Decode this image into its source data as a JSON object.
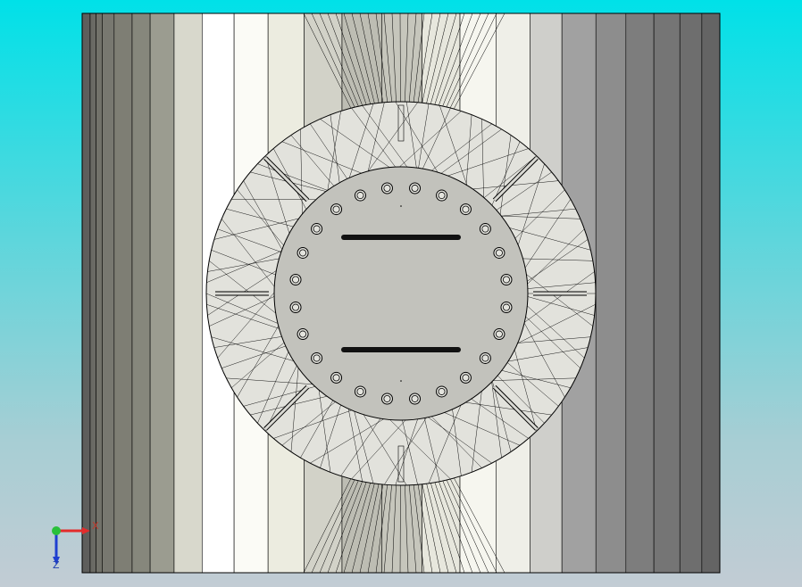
{
  "viewport": {
    "background_top": "#00e1e8",
    "background_bottom": "#c2ccd4"
  },
  "model": {
    "stripe_colors": [
      "#5e5e5c",
      "#6a6a64",
      "#72726a",
      "#787870",
      "#7e7e74",
      "#86877c",
      "#9b9c90",
      "#d8d8cc",
      "#ffffff",
      "#fbfbf6",
      "#ecece0",
      "#d2d2c8",
      "#bdbdb3",
      "#c6c6bc",
      "#e7e7dd",
      "#f6f6ef",
      "#efefe8",
      "#cfcfcb",
      "#a1a1a1",
      "#8d8d8d",
      "#7d7d7d",
      "#757575",
      "#6e6e6e",
      "#646464"
    ],
    "outline_color": "#000000",
    "flange_fill": "#e2e2dc",
    "hub_fill": "#c2c2bc",
    "bolt_count": 24,
    "slot_color": "#111111"
  },
  "triad": {
    "x_label": "X",
    "z_label": "Z",
    "x_color": "#e32b2b",
    "z_color": "#1f3fd0",
    "y_color": "#28c03a"
  }
}
